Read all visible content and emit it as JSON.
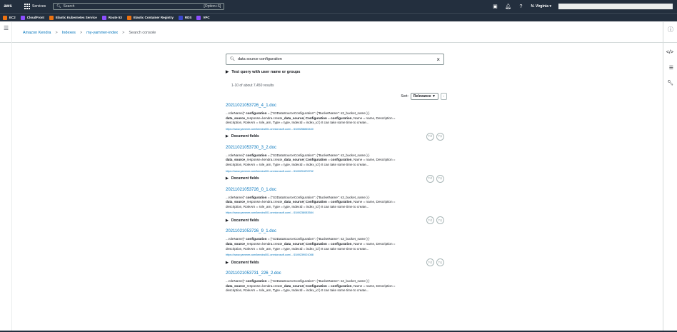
{
  "topnav": {
    "logo": "aws",
    "services_label": "Services",
    "search_placeholder": "Search",
    "search_shortcut": "[Option+S]",
    "region": "N. Virginia ▾",
    "icons": [
      "terminal-icon",
      "bell-icon",
      "help-icon"
    ]
  },
  "favorites": [
    {
      "label": "EC2",
      "color": "#ec7211"
    },
    {
      "label": "CloudFront",
      "color": "#8c4fff"
    },
    {
      "label": "Elastic Kubernetes Service",
      "color": "#ec7211"
    },
    {
      "label": "Route 53",
      "color": "#8c4fff"
    },
    {
      "label": "Elastic Container Registry",
      "color": "#ec7211"
    },
    {
      "label": "RDS",
      "color": "#3b48cc"
    },
    {
      "label": "VPC",
      "color": "#8c4fff"
    }
  ],
  "breadcrumb": {
    "items": [
      "Amazon Kendra",
      "Indexes",
      "my-yammer-index"
    ],
    "current": "Search console",
    "separator": ">"
  },
  "search": {
    "query": "data source configuration",
    "clear_icon": "×"
  },
  "test_query_label": "Test query with user name or groups",
  "results_count": "1-10 of about 7,450 results",
  "sort": {
    "label": "Sort:",
    "value": "Relevance ▼",
    "direction": "↓"
  },
  "document_fields_label": "Document fields",
  "results": [
    {
      "title": "20211021053726_4_1.doc",
      "url": "https://www.yammer.com/kendra001.onmicrosoft.com/.../1549258845440"
    },
    {
      "title": "20211021053730_3_2.doc",
      "url": "https://www.yammer.com/kendra001.onmicrosoft.com/.../1549291878752"
    },
    {
      "title": "20211021053726_0_1.doc",
      "url": "https://www.yammer.com/kendra001.onmicrosoft.com/.../1549238083584"
    },
    {
      "title": "20211021053726_9_1.doc",
      "url": "https://www.yammer.com/kendra001.onmicrosoft.com/.../1549239001088"
    },
    {
      "title": "20211021053731_226_2.doc",
      "url": ""
    }
  ],
  "excerpt": {
    "l1a": "...roleName}\" ",
    "l1b": "configuration",
    "l1c": " = {\"S3DataSourceConfiguration\": {\"BucketName\": s3_bucket_name } }",
    "l2a": "data_source",
    "l2b": "_response=kendra.create_",
    "l2c": "data_source",
    "l2d": "( ",
    "l2e": "Configuration",
    "l2f": " = ",
    "l2g": "configuration",
    "l2h": ", Name = name, Description =",
    "l3": "description, RoleArn = role_arn, Type = type, IndexId = index_id ) It can take some time to create..."
  },
  "rail": {
    "info_icon": "ⓘ"
  }
}
